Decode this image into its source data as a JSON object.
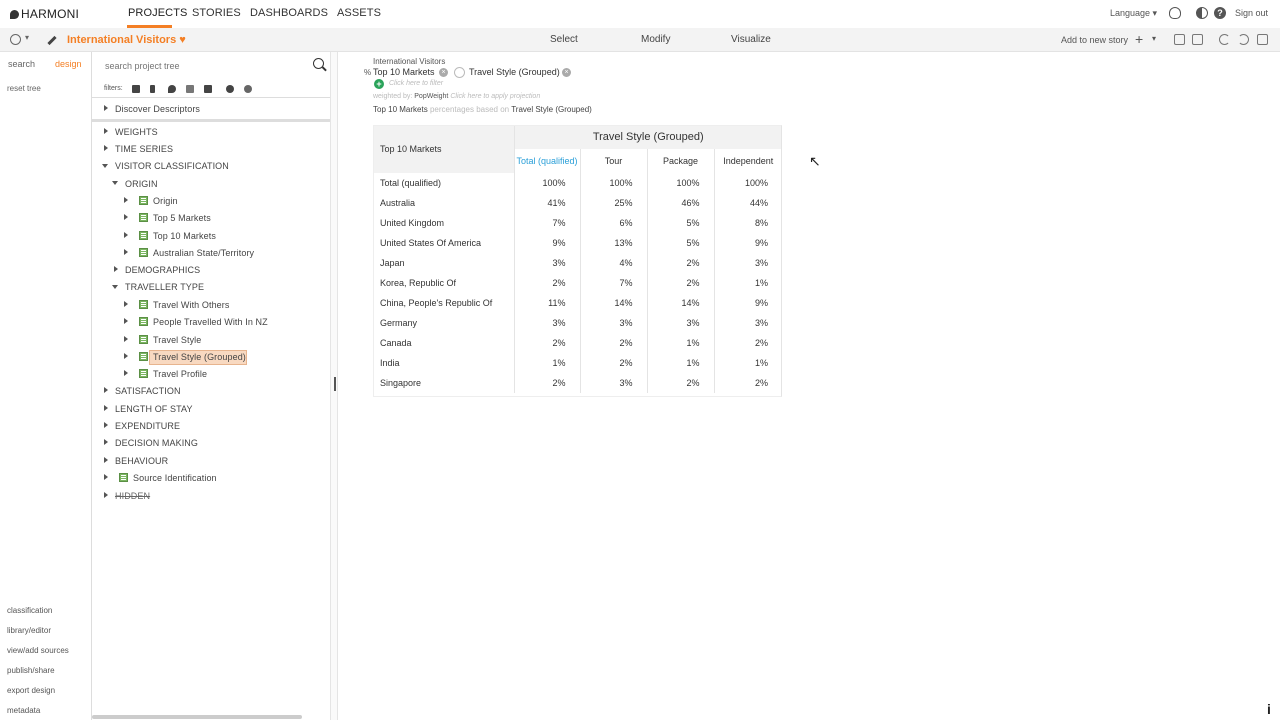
{
  "app": {
    "name": "HARMONI"
  },
  "nav": {
    "items": [
      "PROJECTS",
      "STORIES",
      "DASHBOARDS",
      "ASSETS"
    ],
    "active": "PROJECTS"
  },
  "topright": {
    "language": "Language",
    "signout": "Sign out"
  },
  "toolbar": {
    "project_title": "International Visitors",
    "tabs": [
      "Select",
      "Modify",
      "Visualize"
    ],
    "add_to_story": "Add to new story"
  },
  "rail": {
    "tabs": [
      "search",
      "design"
    ],
    "active_tab": "design",
    "reset": "reset tree",
    "links": [
      "classification",
      "library/editor",
      "view/add sources",
      "publish/share",
      "export design",
      "metadata"
    ]
  },
  "tree": {
    "search_placeholder": "search project tree",
    "filters_label": "filters:",
    "discover": "Discover Descriptors",
    "items": [
      {
        "label": "WEIGHTS"
      },
      {
        "label": "TIME SERIES"
      },
      {
        "label": "VISITOR CLASSIFICATION"
      },
      {
        "label": "ORIGIN"
      },
      {
        "label": "Origin"
      },
      {
        "label": "Top 5 Markets"
      },
      {
        "label": "Top 10 Markets"
      },
      {
        "label": "Australian State/Territory"
      },
      {
        "label": "DEMOGRAPHICS"
      },
      {
        "label": "TRAVELLER TYPE"
      },
      {
        "label": "Travel With Others"
      },
      {
        "label": "People Travelled With In NZ"
      },
      {
        "label": "Travel Style"
      },
      {
        "label": "Travel Style (Grouped)"
      },
      {
        "label": "Travel Profile"
      },
      {
        "label": "SATISFACTION"
      },
      {
        "label": "LENGTH OF STAY"
      },
      {
        "label": "EXPENDITURE"
      },
      {
        "label": "DECISION MAKING"
      },
      {
        "label": "BEHAVIOUR"
      },
      {
        "label": "Source Identification"
      },
      {
        "label": "HIDDEN"
      }
    ]
  },
  "query": {
    "dataset": "International Visitors",
    "pct": "%",
    "row_var": "Top 10 Markets",
    "col_var": "Travel Style (Grouped)",
    "filter_placeholder": "Click here to filter",
    "weighted_prefix": "weighted by:",
    "weight": "PopWeight",
    "projection_placeholder": "Click here to apply projection",
    "based_row": "Top 10 Markets",
    "based_mid": "percentages based on",
    "based_col": "Travel Style (Grouped)"
  },
  "table": {
    "row_header": "Top 10 Markets",
    "col_group": "Travel Style (Grouped)",
    "total_col": "Total (qualified)",
    "columns": [
      "Tour",
      "Package",
      "Independent"
    ],
    "rows": [
      {
        "label": "Total (qualified)",
        "v": [
          "100%",
          "100%",
          "100%",
          "100%"
        ]
      },
      {
        "label": "Australia",
        "v": [
          "41%",
          "25%",
          "46%",
          "44%"
        ]
      },
      {
        "label": "United Kingdom",
        "v": [
          "7%",
          "6%",
          "5%",
          "8%"
        ]
      },
      {
        "label": "United States Of America",
        "v": [
          "9%",
          "13%",
          "5%",
          "9%"
        ]
      },
      {
        "label": "Japan",
        "v": [
          "3%",
          "4%",
          "2%",
          "3%"
        ]
      },
      {
        "label": "Korea, Republic Of",
        "v": [
          "2%",
          "7%",
          "2%",
          "1%"
        ]
      },
      {
        "label": "China, People's Republic Of",
        "v": [
          "11%",
          "14%",
          "14%",
          "9%"
        ]
      },
      {
        "label": "Germany",
        "v": [
          "3%",
          "3%",
          "3%",
          "3%"
        ]
      },
      {
        "label": "Canada",
        "v": [
          "2%",
          "2%",
          "1%",
          "2%"
        ]
      },
      {
        "label": "India",
        "v": [
          "1%",
          "2%",
          "1%",
          "1%"
        ]
      },
      {
        "label": "Singapore",
        "v": [
          "2%",
          "3%",
          "2%",
          "2%"
        ]
      }
    ]
  },
  "colors": {
    "accent": "#f47f24",
    "total_col": "#2a9fd8",
    "add": "#2aa35a"
  }
}
